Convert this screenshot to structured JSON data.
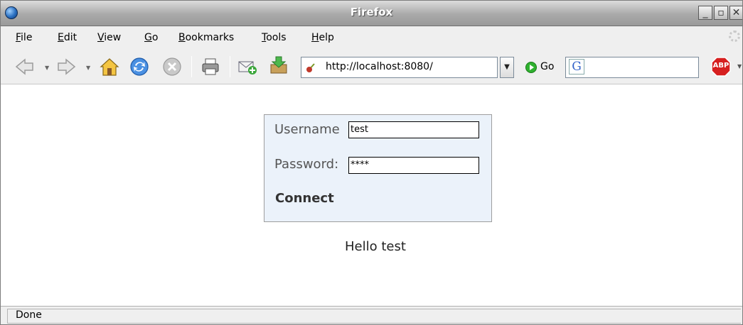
{
  "window": {
    "title": "Firefox"
  },
  "menu": {
    "items": [
      {
        "accel": "F",
        "rest": "ile"
      },
      {
        "accel": "E",
        "rest": "dit"
      },
      {
        "accel": "V",
        "rest": "iew"
      },
      {
        "accel": "G",
        "rest": "o"
      },
      {
        "accel": "B",
        "rest": "ookmarks"
      },
      {
        "accel": "T",
        "rest": "ools"
      },
      {
        "accel": "H",
        "rest": "elp"
      }
    ]
  },
  "toolbar": {
    "url": "http://localhost:8080/",
    "go_label": "Go",
    "search_engine_glyph": "G",
    "adblock_label": "ABP",
    "icons": [
      "back-icon",
      "forward-icon",
      "home-icon",
      "reload-icon",
      "stop-icon",
      "print-icon",
      "new-mail-icon",
      "downloads-icon",
      "site-favicon-icon",
      "go-icon",
      "google-search-icon",
      "adblock-plus-icon"
    ]
  },
  "login": {
    "username_label": "Username",
    "username_value": "test",
    "password_label": "Password:",
    "password_value": "****",
    "connect_label": "Connect"
  },
  "greeting": "Hello test",
  "status": {
    "text": "Done"
  },
  "colors": {
    "login_box_bg": "#ebf2fa",
    "title_text": "#ffffff"
  }
}
